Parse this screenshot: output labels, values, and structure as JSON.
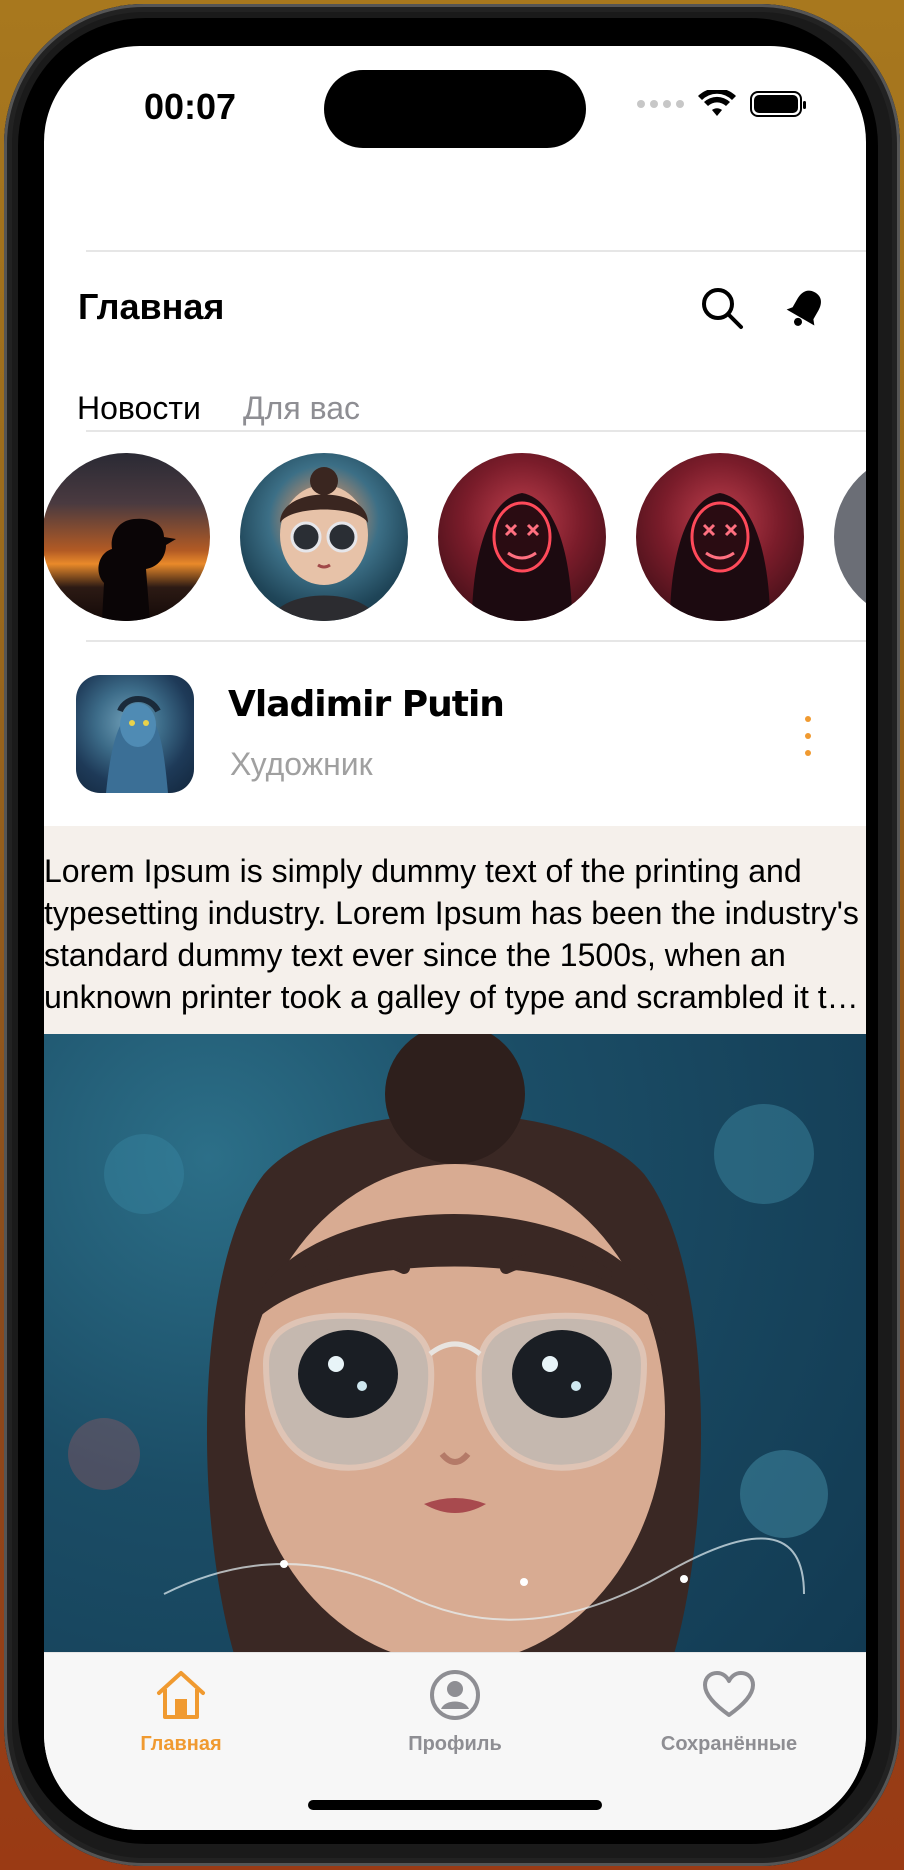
{
  "status_bar": {
    "time": "00:07"
  },
  "header": {
    "title": "Главная"
  },
  "tabs": [
    {
      "label": "Новости",
      "active": true
    },
    {
      "label": "Для вас",
      "active": false
    }
  ],
  "post": {
    "author": "Vladimir Putin",
    "role": "Художник",
    "text": "Lorem Ipsum is simply dummy text of the printing and typesetting industry. Lorem Ipsum has been the industry's standard dummy text ever since the 1500s, when an unknown printer took a galley of type and scrambled it to make a type specimen book."
  },
  "tabbar": {
    "items": [
      {
        "label": "Главная",
        "icon": "home-icon",
        "active": true
      },
      {
        "label": "Профиль",
        "icon": "profile-icon",
        "active": false
      },
      {
        "label": "Сохранённые",
        "icon": "heart-icon",
        "active": false
      }
    ]
  },
  "colors": {
    "accent": "#f09a30",
    "inactive": "#8e8e93"
  },
  "icons": [
    "wifi-icon",
    "battery-icon",
    "search-icon",
    "bell-icon",
    "more-vertical-icon"
  ]
}
